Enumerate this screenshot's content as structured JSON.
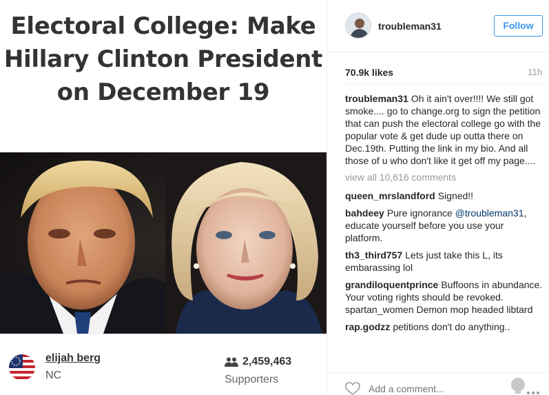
{
  "petition": {
    "headline_lines": [
      "Electoral College: Make",
      "Hillary Clinton President",
      "on December 19"
    ],
    "author": {
      "name": "elijah berg",
      "location": "NC",
      "avatar_icon": "us-flag-icon"
    },
    "supporters": {
      "count": "2,459,463",
      "label": "Supporters",
      "icon": "people-icon"
    }
  },
  "post": {
    "username": "troubleman31",
    "follow_label": "Follow",
    "likes": "70.9k likes",
    "time": "11h",
    "caption": {
      "user": "troubleman31",
      "text": "Oh it ain't over!!!! We still got smoke.... go to change.org to sign the petition that can push the electoral college go with the popular vote & get dude up outta there on Dec.19th. Putting the link in my bio. And all those of u who don't like it get off my page...."
    },
    "view_all": "view all 10,616 comments",
    "comments": [
      {
        "user": "queen_mrslandford",
        "text": "Signed!!"
      },
      {
        "user": "bahdeey",
        "text_before": "Pure ignorance ",
        "mention": "@troubleman31",
        "text": ", educate yourself before you use your platform."
      },
      {
        "user": "th3_third757",
        "text": "Lets just take this L, its embarassing lol"
      },
      {
        "user": "grandiloquentprince",
        "text": "Buffoons in abundance. Your voting rights should be revoked. spartan_women Demon mop headed libtard"
      },
      {
        "user": "rap.godzz",
        "text": "petitions don't do anything.."
      }
    ],
    "add_comment_placeholder": "Add a comment...",
    "accent_color": "#3897f0"
  }
}
